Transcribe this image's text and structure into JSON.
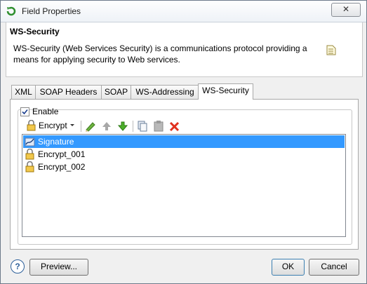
{
  "window": {
    "title": "Field Properties",
    "close_label": "✕"
  },
  "header": {
    "title": "WS-Security",
    "description": "WS-Security (Web Services Security) is a communications protocol providing a means for applying security to Web services."
  },
  "tabs": [
    {
      "label": "XML"
    },
    {
      "label": "SOAP Headers"
    },
    {
      "label": "SOAP"
    },
    {
      "label": "WS-Addressing"
    },
    {
      "label": "WS-Security",
      "active": true
    }
  ],
  "panel": {
    "enable_label": "Enable",
    "enable_checked": true,
    "toolbar": {
      "encrypt_label": "Encrypt"
    },
    "items": [
      {
        "label": "Signature",
        "icon": "signature-icon",
        "selected": true
      },
      {
        "label": "Encrypt_001",
        "icon": "lock-icon"
      },
      {
        "label": "Encrypt_002",
        "icon": "lock-icon"
      }
    ]
  },
  "footer": {
    "help_label": "?",
    "preview_label": "Preview...",
    "ok_label": "OK",
    "cancel_label": "Cancel"
  }
}
